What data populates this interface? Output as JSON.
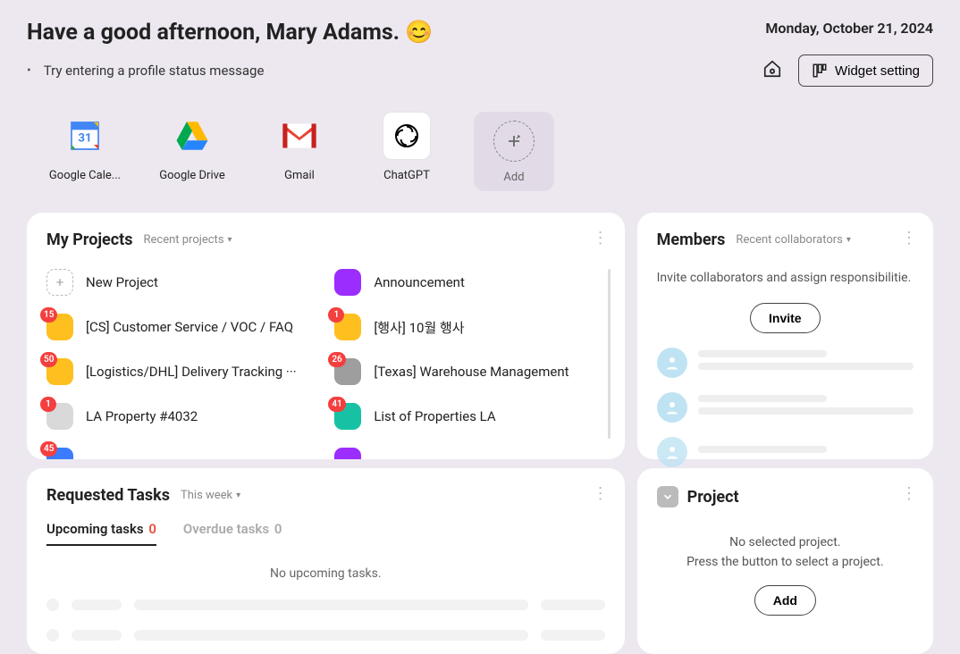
{
  "header": {
    "greeting": "Have a good afternoon, Mary Adams. 😊",
    "date": "Monday, October 21, 2024",
    "status_prompt": "Try entering a profile status message",
    "widget_btn": "Widget setting"
  },
  "shortcuts": [
    {
      "label": "Google Cale...",
      "icon": "calendar"
    },
    {
      "label": "Google Drive",
      "icon": "drive"
    },
    {
      "label": "Gmail",
      "icon": "gmail"
    },
    {
      "label": "ChatGPT",
      "icon": "chatgpt"
    },
    {
      "label": "Add",
      "icon": "add"
    }
  ],
  "projects": {
    "title": "My Projects",
    "filter": "Recent projects",
    "items": [
      {
        "label": "New Project",
        "color": "add",
        "badge": null
      },
      {
        "label": "Announcement",
        "color": "#9b2dff",
        "badge": null
      },
      {
        "label": "[CS] Customer Service / VOC / FAQ",
        "color": "#ffbf1f",
        "badge": "15"
      },
      {
        "label": "[행사] 10월 행사",
        "color": "#ffbf1f",
        "badge": "1"
      },
      {
        "label": "[Logistics/DHL] Delivery Tracking ···",
        "color": "#ffbf1f",
        "badge": "50"
      },
      {
        "label": "[Texas] Warehouse Management",
        "color": "#9e9e9e",
        "badge": "26"
      },
      {
        "label": "LA Property #4032",
        "color": "#d9d9d9",
        "badge": "1"
      },
      {
        "label": "List of Properties LA",
        "color": "#17c2a4",
        "badge": "41"
      },
      {
        "label": "",
        "color": "#3a7bff",
        "badge": "45"
      },
      {
        "label": "",
        "color": "#9b2dff",
        "badge": null
      }
    ]
  },
  "members": {
    "title": "Members",
    "filter": "Recent collaborators",
    "prompt": "Invite collaborators and assign responsibilitie.",
    "invite_btn": "Invite"
  },
  "tasks": {
    "title": "Requested Tasks",
    "filter": "This week",
    "tab1_label": "Upcoming tasks",
    "tab1_count": "0",
    "tab2_label": "Overdue tasks",
    "tab2_count": "0",
    "empty": "No upcoming tasks."
  },
  "project_widget": {
    "title": "Project",
    "line1": "No selected project.",
    "line2": "Press the button to select a project.",
    "add_btn": "Add"
  }
}
